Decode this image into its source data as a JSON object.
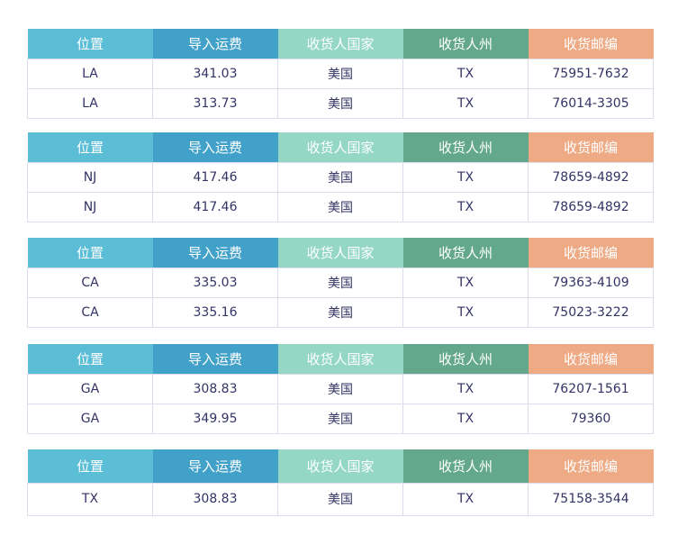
{
  "headers": [
    "位置",
    "导入运费",
    "收货人国家",
    "收货人州",
    "收货邮编"
  ],
  "tables": [
    {
      "rows": [
        [
          "LA",
          "341.03",
          "美国",
          "TX",
          "75951-7632"
        ],
        [
          "LA",
          "313.73",
          "美国",
          "TX",
          "76014-3305"
        ]
      ]
    },
    {
      "rows": [
        [
          "NJ",
          "417.46",
          "美国",
          "TX",
          "78659-4892"
        ],
        [
          "NJ",
          "417.46",
          "美国",
          "TX",
          "78659-4892"
        ]
      ]
    },
    {
      "rows": [
        [
          "CA",
          "335.03",
          "美国",
          "TX",
          "79363-4109"
        ],
        [
          "CA",
          "335.16",
          "美国",
          "TX",
          "75023-3222"
        ]
      ]
    },
    {
      "rows": [
        [
          "GA",
          "308.83",
          "美国",
          "TX",
          "76207-1561"
        ],
        [
          "GA",
          "349.95",
          "美国",
          "TX",
          "79360"
        ]
      ]
    },
    {
      "rows": [
        [
          "TX",
          "308.83",
          "美国",
          "TX",
          "75158-3544"
        ]
      ]
    }
  ],
  "colors": {
    "header_location": "#5bbdd6",
    "header_freight": "#42a1c9",
    "header_country": "#93d7c4",
    "header_state": "#63a88c",
    "header_zip": "#eeaa85",
    "cell_text": "#333366"
  }
}
